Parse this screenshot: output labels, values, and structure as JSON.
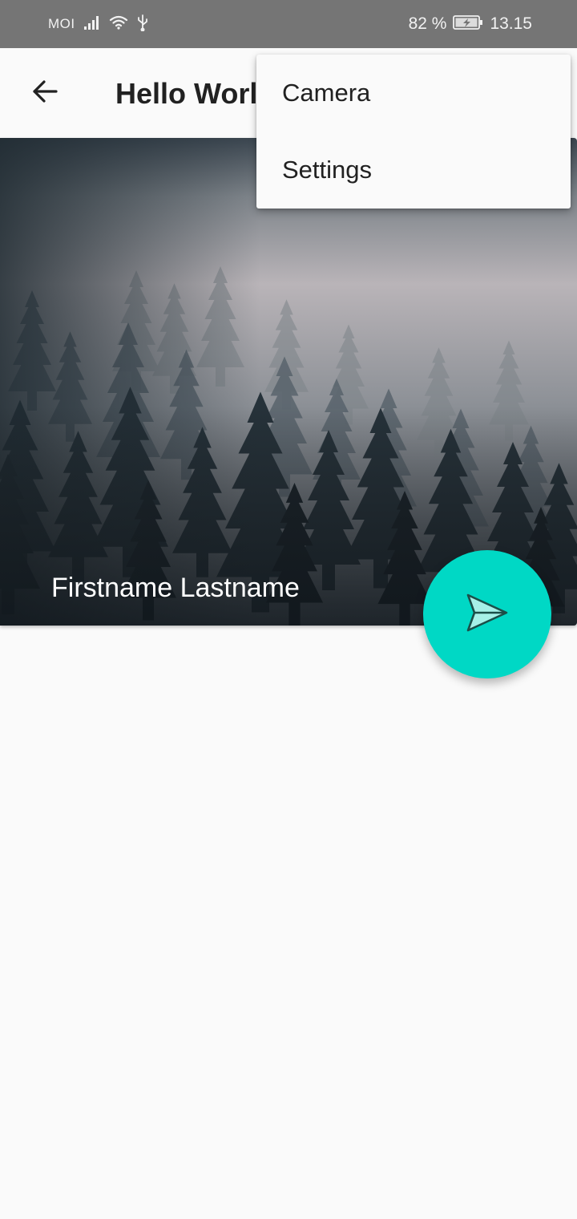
{
  "status_bar": {
    "carrier": "MOI",
    "battery": "82 %",
    "time": "13.15",
    "icons": [
      "signal-icon",
      "wifi-icon",
      "usb-icon",
      "battery-charging-icon"
    ]
  },
  "app_bar": {
    "title": "Hello World",
    "back_icon": "arrow-left-icon"
  },
  "card": {
    "name": "Firstname Lastname",
    "image": "foggy-forest"
  },
  "fab": {
    "icon": "send-icon",
    "color": "#00d8c5"
  },
  "overflow_menu": {
    "items": [
      {
        "label": "Camera"
      },
      {
        "label": "Settings"
      }
    ]
  }
}
